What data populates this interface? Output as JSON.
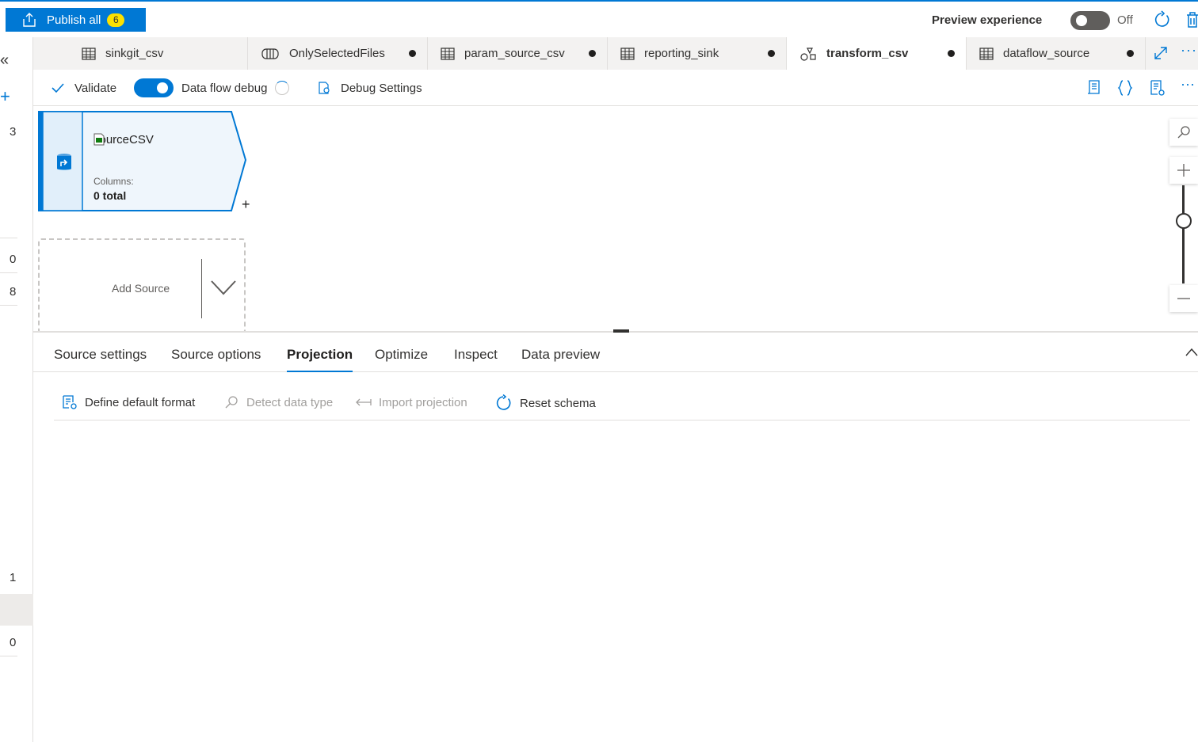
{
  "topbar": {
    "publish_label": "Publish all",
    "publish_count": "6",
    "preview_label": "Preview experience",
    "preview_state": "Off"
  },
  "leftrail": {
    "collapse_glyph": "«",
    "add_glyph": "+",
    "numbers": [
      "3",
      "0",
      "8",
      "1",
      "0"
    ]
  },
  "tabs": [
    {
      "label": "sinkgit_csv",
      "icon": "table-icon",
      "dirty": false,
      "active": false
    },
    {
      "label": "OnlySelectedFiles",
      "icon": "pipeline-icon",
      "dirty": true,
      "active": false
    },
    {
      "label": "param_source_csv",
      "icon": "table-icon",
      "dirty": true,
      "active": false
    },
    {
      "label": "reporting_sink",
      "icon": "table-icon",
      "dirty": true,
      "active": false
    },
    {
      "label": "transform_csv",
      "icon": "dataflow-icon",
      "dirty": true,
      "active": true
    },
    {
      "label": "dataflow_source",
      "icon": "table-icon",
      "dirty": true,
      "active": false
    }
  ],
  "toolbar": {
    "validate_label": "Validate",
    "debug_label": "Data flow debug",
    "debug_settings_label": "Debug Settings",
    "debug_on": true
  },
  "canvas": {
    "node": {
      "name": "sourceCSV",
      "columns_label": "Columns:",
      "columns_value": "0 total",
      "add_glyph": "+"
    },
    "add_source_label": "Add Source"
  },
  "panel_tabs": [
    "Source settings",
    "Source options",
    "Projection",
    "Optimize",
    "Inspect",
    "Data preview"
  ],
  "panel_active_tab": "Projection",
  "projection_toolbar": {
    "define_default_format": "Define default format",
    "detect_data_type": "Detect data type",
    "import_projection": "Import projection",
    "reset_schema": "Reset schema"
  },
  "colors": {
    "accent": "#0078d4",
    "badge": "#fce100",
    "node_fill": "#eff6fc"
  }
}
